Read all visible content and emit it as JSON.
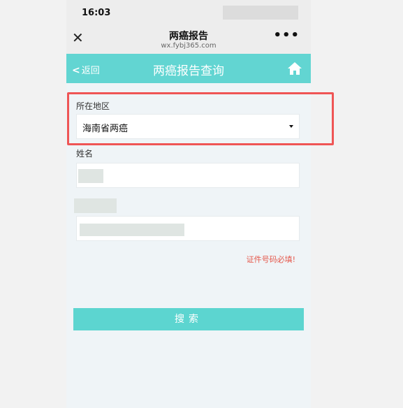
{
  "status": {
    "time": "16:03"
  },
  "wechat": {
    "title": "两癌报告",
    "url": "wx.fybj365.com",
    "close": "✕",
    "more": "•••"
  },
  "header": {
    "back_chevron": "<",
    "back_label": "返回",
    "title": "两癌报告查询"
  },
  "form": {
    "region_label": "所在地区",
    "region_value": "海南省两癌",
    "name_label": "姓名",
    "id_error": "证件号码必填!"
  },
  "search_button": "搜索",
  "colors": {
    "header": "#62d5d2",
    "button": "#5cd5d0",
    "error": "#e5584c",
    "highlight": "#ef5555"
  }
}
